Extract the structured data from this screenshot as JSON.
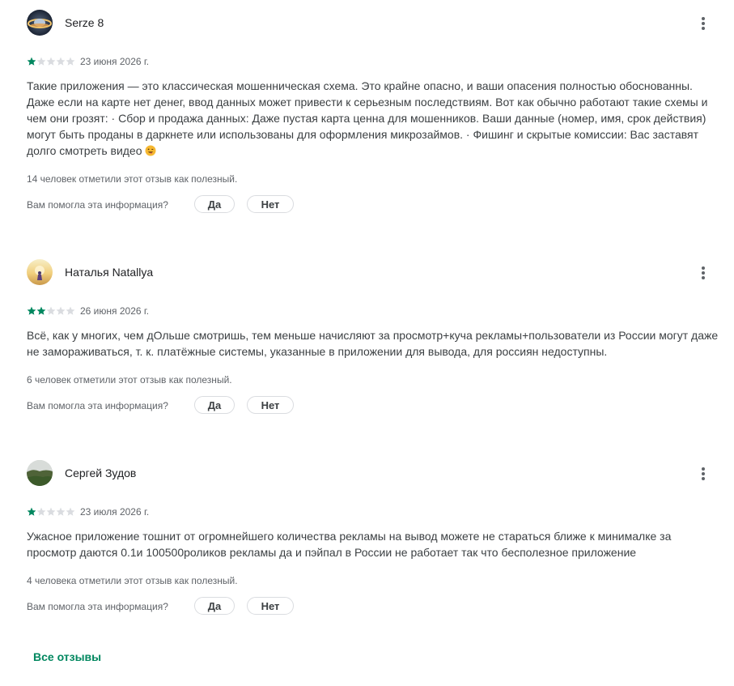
{
  "colors": {
    "star_filled": "#01875f",
    "star_empty": "#dadce0",
    "link": "#01875f"
  },
  "reviews": [
    {
      "author": "Serze 8",
      "avatar_icon": "planet-ring-avatar",
      "rating": 1,
      "date": "23 июня 2026 г.",
      "text": "Такие приложения — это классическая мошенническая схема. Это крайне опасно, и ваши опасения полностью обоснованны. Даже если на карте нет денег, ввод данных может привести к серьезным последствиям. Вот как обычно работают такие схемы и чем они грозят: · Сбор и продажа данных: Даже пустая карта ценна для мошенников. Ваши данные (номер, имя, срок действия) могут быть проданы в даркнете или использованы для оформления микрозаймов. · Фишинг и скрытые комиссии: Вас заставят долго смотреть видео",
      "emoji": "winking-face-tongue-emoji",
      "helpful": "14 человек отметили этот отзыв как полезный.",
      "question": "Вам помогла эта информация?",
      "yes": "Да",
      "no": "Нет"
    },
    {
      "author": "Наталья Natallya",
      "avatar_icon": "sunset-person-avatar",
      "rating": 2,
      "date": "26 июня 2026 г.",
      "text": "Всё, как у многих, чем дОльше смотришь, тем меньше начисляют за просмотр+куча рекламы+пользователи из России могут даже не замораживаться, т. к. платёжные системы, указанные в приложении для вывода, для россиян недоступны.",
      "helpful": "6 человек отметили этот отзыв как полезный.",
      "question": "Вам помогла эта информация?",
      "yes": "Да",
      "no": "Нет"
    },
    {
      "author": "Сергей Зудов",
      "avatar_icon": "landscape-avatar",
      "rating": 1,
      "date": "23 июля 2026 г.",
      "text": "Ужасное приложение тошнит от огромнейшего количества рекламы на вывод можете не стараться ближе к минималке за просмотр даются 0.1и 100500роликов рекламы да и пэйпал в России не работает так что бесполезное приложение",
      "helpful": "4 человека отметили этот отзыв как полезный.",
      "question": "Вам помогла эта информация?",
      "yes": "Да",
      "no": "Нет"
    }
  ],
  "footer": {
    "all_reviews": "Все отзывы"
  }
}
